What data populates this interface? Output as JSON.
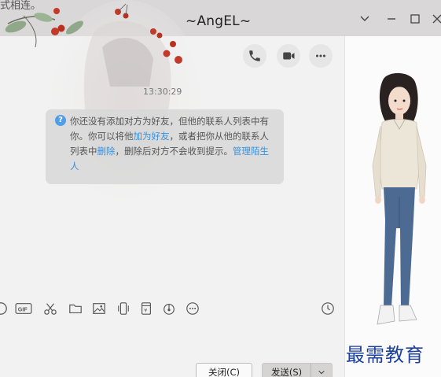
{
  "window": {
    "top_fragment": "式相连。",
    "title": "~AngEL~"
  },
  "chat": {
    "timestamp": "13:30:29",
    "notice": {
      "text1": "你还没有添加对方为好友，但他的联系人列表中有你。你可以将他",
      "link_add": "加为好友",
      "text2": "，或者把你从他的联系人列表中",
      "link_delete": "删除",
      "text3": "，删除后对方不会收到提示。",
      "link_manage": "管理陌生人"
    }
  },
  "buttons": {
    "close": "关闭(C)",
    "send": "发送(S)"
  },
  "toolbar_icons": [
    "emoji-icon",
    "gif-icon",
    "scissors-icon",
    "folder-icon",
    "image-icon",
    "shake-icon",
    "red-packet-icon",
    "music-icon",
    "more-icon",
    "history-clock-icon"
  ],
  "watermark": "最需教育",
  "colors": {
    "link": "#3a8fd9",
    "notice_bg": "#d8d8d8",
    "watermark": "#1d3fa0"
  }
}
